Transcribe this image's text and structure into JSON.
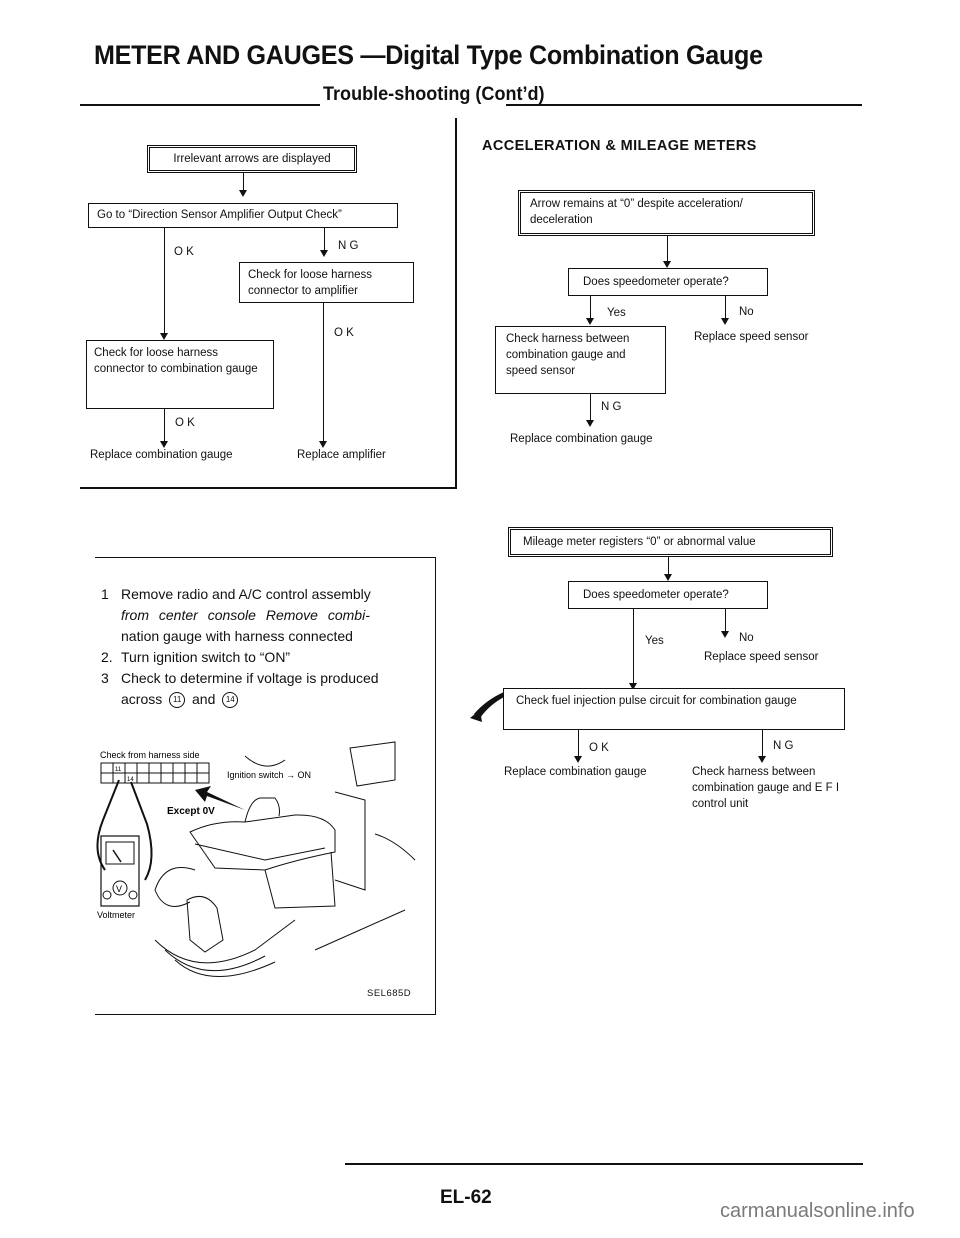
{
  "header": {
    "title": "METER AND GAUGES —Digital Type Combination Gauge",
    "subtitle": "Trouble-shooting (Cont’d)"
  },
  "left_flow": {
    "start": "Irrelevant arrows are displayed",
    "step1": "Go to “Direction Sensor Amplifier Output Check”",
    "label_ok_1": "O K",
    "label_ng_1": "N G",
    "ng_box": "Check for loose harness connector to amplifier",
    "ok_box": "Check for loose harness connector to combination gauge",
    "label_ok_2": "O K",
    "label_ok_3": "O K",
    "result_left": "Replace combination gauge",
    "result_right": "Replace amplifier"
  },
  "instructions": {
    "items": [
      {
        "num": "1",
        "text": "Remove radio and A/C control assembly from center console Remove combination gauge with harness connected"
      },
      {
        "num": "2.",
        "text": "Turn ignition switch to “ON”"
      },
      {
        "num": "3",
        "text": "Check to determine if voltage is produced across ①① and ⑭"
      }
    ],
    "item1_line1": "Remove radio and A/C control assembly",
    "item1_line2": "from center console Remove combi-",
    "item1_line3": "nation gauge with harness connected",
    "item3_line1": "Check to determine if voltage is produced",
    "item3_line2_a": "across",
    "item3_line2_b": "and",
    "terminal_a": "11",
    "terminal_b": "14"
  },
  "illustration": {
    "label_harness": "Check from harness side",
    "label_ignition": "Ignition switch → ON",
    "label_except": "Except 0V",
    "label_voltmeter": "Voltmeter",
    "meter_symbol": "V",
    "plus": "+",
    "minus": "−",
    "pin_a": "11",
    "pin_b": "14",
    "figure_code": "SEL685D"
  },
  "right_section": {
    "heading": "ACCELERATION & MILEAGE METERS",
    "flow1": {
      "start_line1": "Arrow remains at “0” despite acceleration/",
      "start_line2": "deceleration",
      "question": "Does speedometer operate?",
      "label_yes": "Yes",
      "label_no": "No",
      "yes_box": "Check harness between combination gauge and speed sensor",
      "no_result": "Replace speed sensor",
      "label_ng": "N G",
      "ng_result": "Replace combination gauge"
    },
    "flow2": {
      "start": "Mileage meter registers “0” or abnormal value",
      "question": "Does speedometer operate?",
      "label_yes": "Yes",
      "label_no": "No",
      "no_result": "Replace speed sensor",
      "check_box": "Check fuel injection pulse circuit for combination gauge",
      "label_ok": "O K",
      "label_ng": "N G",
      "ok_result": "Replace combination gauge",
      "ng_result": "Check harness between combination gauge and E F I control unit"
    }
  },
  "footer": {
    "page_number": "EL-62",
    "watermark": "carmanualsonline.info"
  }
}
